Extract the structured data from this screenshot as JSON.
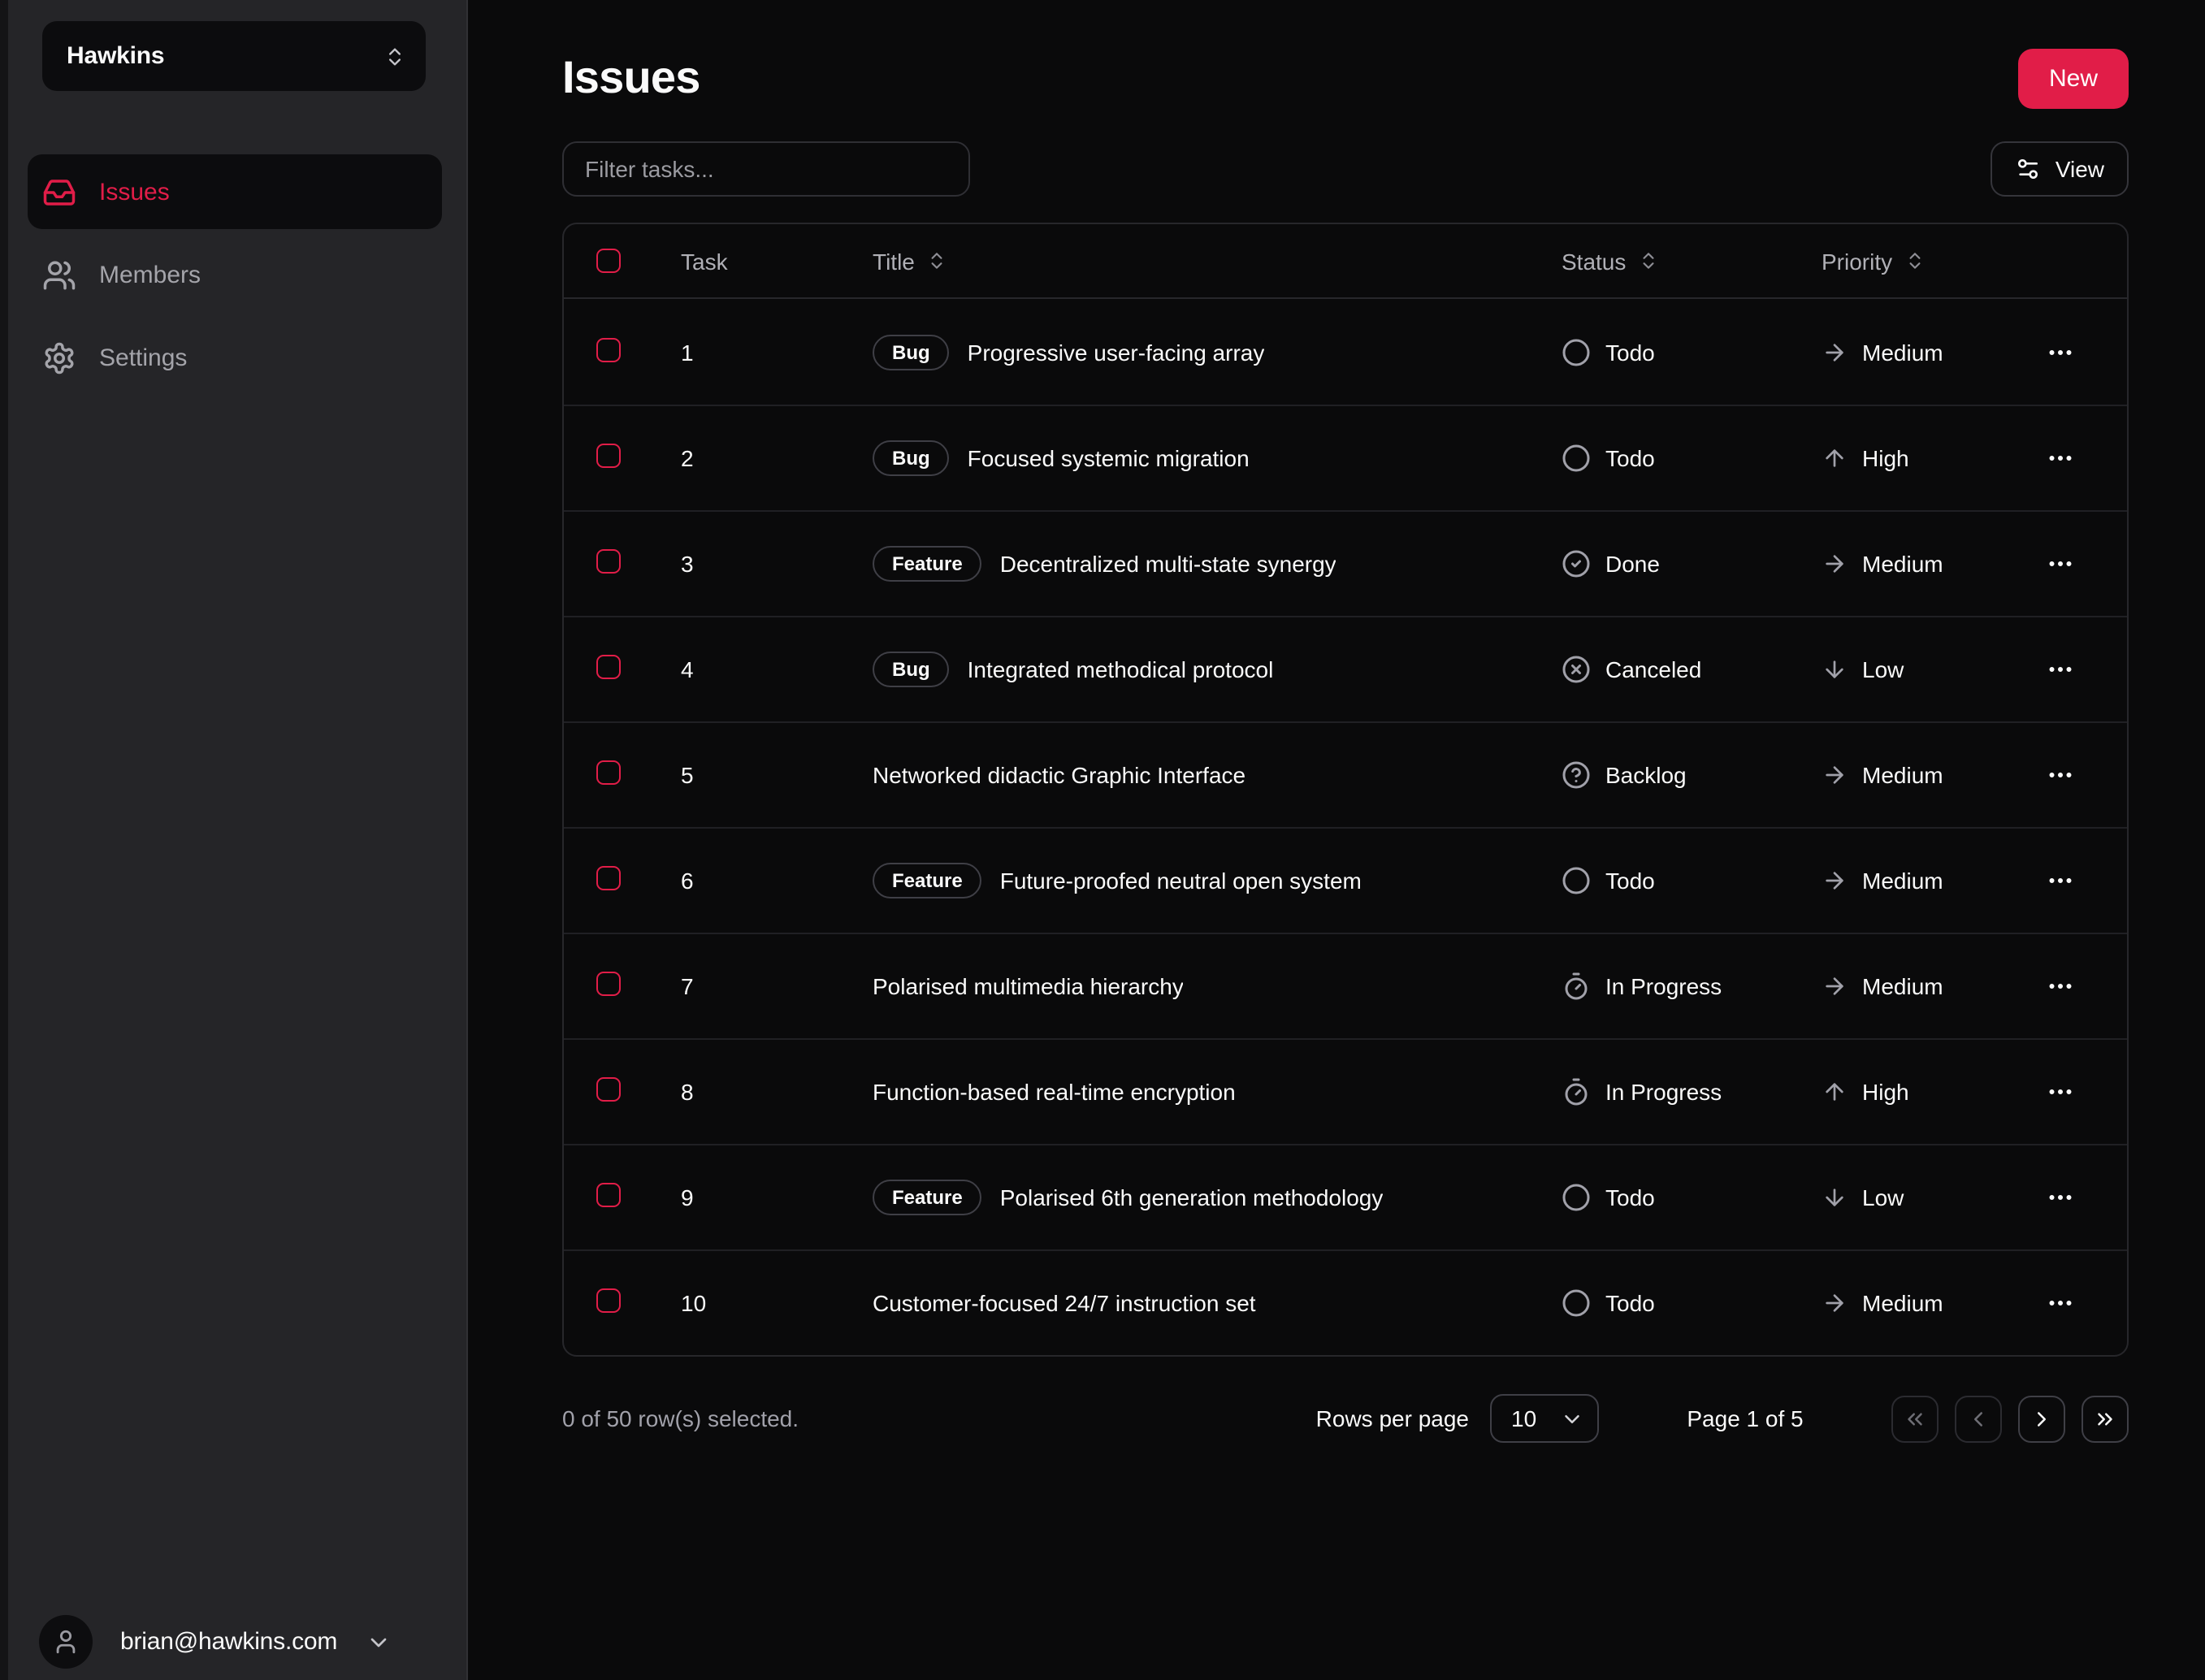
{
  "colors": {
    "accent": "#e11d48",
    "page_bg": "#0a0a0b",
    "sidebar_bg": "#252528",
    "text": "#fafafa",
    "muted": "#a1a1aa"
  },
  "workspace": {
    "name": "Hawkins",
    "switcher_icon": "chevrons-up-down"
  },
  "sidebar": {
    "items": [
      {
        "label": "Issues",
        "icon": "inbox",
        "active": true
      },
      {
        "label": "Members",
        "icon": "users",
        "active": false
      },
      {
        "label": "Settings",
        "icon": "settings",
        "active": false
      }
    ],
    "user": {
      "email": "brian@hawkins.com",
      "avatar_icon": "user",
      "caret_icon": "chevron-down"
    }
  },
  "header": {
    "title": "Issues",
    "new_button": "New",
    "filter_placeholder": "Filter tasks...",
    "view_button": "View",
    "view_icon": "settings2"
  },
  "table": {
    "columns": [
      {
        "label": "Task",
        "sortable": false
      },
      {
        "label": "Title",
        "sortable": true
      },
      {
        "label": "Status",
        "sortable": true
      },
      {
        "label": "Priority",
        "sortable": true
      }
    ],
    "sort_icon": "chevrons-up-down",
    "row_menu_icon": "ellipsis",
    "rows": [
      {
        "task": "1",
        "badge": "Bug",
        "title": "Progressive user-facing array",
        "status": "Todo",
        "status_icon": "circle",
        "priority": "Medium",
        "priority_icon": "arrow-right"
      },
      {
        "task": "2",
        "badge": "Bug",
        "title": "Focused systemic migration",
        "status": "Todo",
        "status_icon": "circle",
        "priority": "High",
        "priority_icon": "arrow-up"
      },
      {
        "task": "3",
        "badge": "Feature",
        "title": "Decentralized multi-state synergy",
        "status": "Done",
        "status_icon": "circle-check",
        "priority": "Medium",
        "priority_icon": "arrow-right"
      },
      {
        "task": "4",
        "badge": "Bug",
        "title": "Integrated methodical protocol",
        "status": "Canceled",
        "status_icon": "circle-x",
        "priority": "Low",
        "priority_icon": "arrow-down"
      },
      {
        "task": "5",
        "badge": null,
        "title": "Networked didactic Graphic Interface",
        "status": "Backlog",
        "status_icon": "circle-help",
        "priority": "Medium",
        "priority_icon": "arrow-right"
      },
      {
        "task": "6",
        "badge": "Feature",
        "title": "Future-proofed neutral open system",
        "status": "Todo",
        "status_icon": "circle",
        "priority": "Medium",
        "priority_icon": "arrow-right"
      },
      {
        "task": "7",
        "badge": null,
        "title": "Polarised multimedia hierarchy",
        "status": "In Progress",
        "status_icon": "timer",
        "priority": "Medium",
        "priority_icon": "arrow-right"
      },
      {
        "task": "8",
        "badge": null,
        "title": "Function-based real-time encryption",
        "status": "In Progress",
        "status_icon": "timer",
        "priority": "High",
        "priority_icon": "arrow-up"
      },
      {
        "task": "9",
        "badge": "Feature",
        "title": "Polarised 6th generation methodology",
        "status": "Todo",
        "status_icon": "circle",
        "priority": "Low",
        "priority_icon": "arrow-down"
      },
      {
        "task": "10",
        "badge": null,
        "title": "Customer-focused 24/7 instruction set",
        "status": "Todo",
        "status_icon": "circle",
        "priority": "Medium",
        "priority_icon": "arrow-right"
      }
    ]
  },
  "footer": {
    "selection": "0 of 50 row(s) selected.",
    "rows_per_page_label": "Rows per page",
    "rows_per_page_value": "10",
    "page_label": "Page 1 of 5",
    "pagination_buttons": [
      {
        "name": "first-page-button",
        "icon": "chevrons-left",
        "disabled": true
      },
      {
        "name": "previous-page-button",
        "icon": "chevron-left",
        "disabled": true
      },
      {
        "name": "next-page-button",
        "icon": "chevron-right",
        "disabled": false
      },
      {
        "name": "last-page-button",
        "icon": "chevrons-right",
        "disabled": false
      }
    ]
  }
}
